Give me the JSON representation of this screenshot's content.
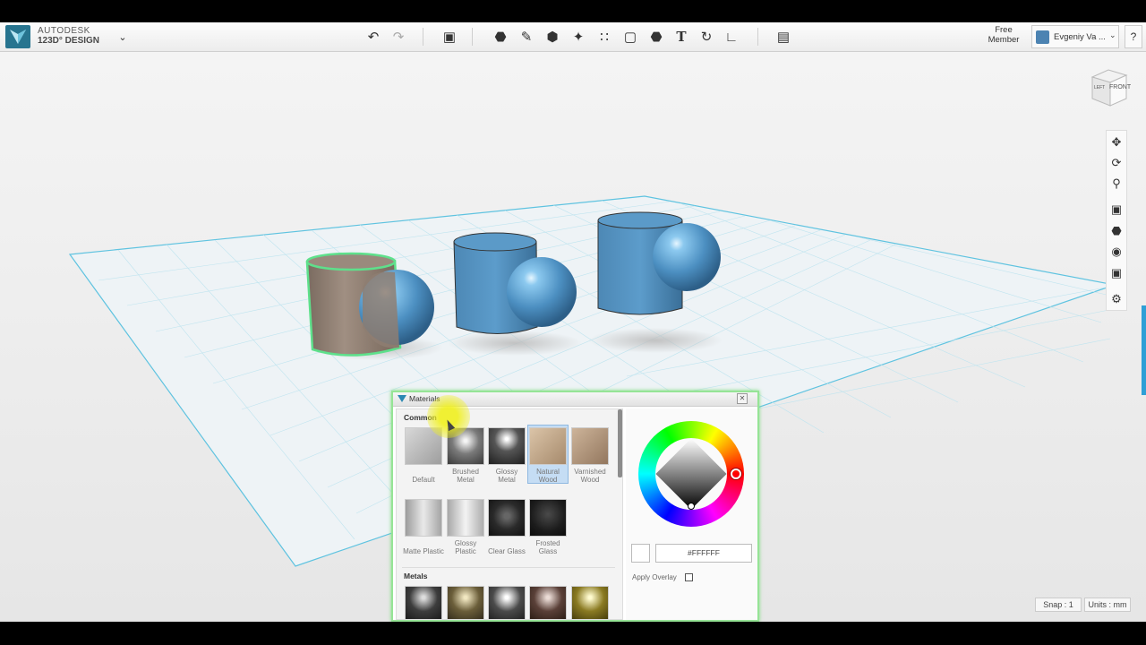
{
  "app": {
    "brand_line1": "AUTODESK",
    "brand_line2": "123D° DESIGN",
    "account": {
      "line1": "Free",
      "line2": "Member"
    },
    "user_name": "Evgeniy Va ...",
    "help": "?"
  },
  "toolbar": {
    "icons": [
      "undo-icon",
      "redo-icon",
      "transform-icon",
      "primitives-icon",
      "sketch-icon",
      "construct-icon",
      "modify-icon",
      "pattern-icon",
      "grouping-icon",
      "combine-icon",
      "text-icon",
      "snap-icon",
      "measure-icon",
      "material-icon"
    ]
  },
  "viewcube": {
    "left_label": "LEFT",
    "front_label": "FRONT"
  },
  "nav_tools": [
    "pan-icon",
    "orbit-icon",
    "zoom-icon",
    "fit-icon",
    "view-icon",
    "visibility-icon",
    "camera-icon",
    "settings-icon"
  ],
  "materials_panel": {
    "title": "Materials",
    "sections": [
      {
        "name": "Common",
        "items": [
          {
            "label_1": "",
            "label_2": "Default",
            "selected": false,
            "color": "#b9b9b9"
          },
          {
            "label_1": "Brushed",
            "label_2": "Metal",
            "selected": false,
            "color": "#7a7a7a"
          },
          {
            "label_1": "Glossy",
            "label_2": "Metal",
            "selected": false,
            "color": "#555555"
          },
          {
            "label_1": "Natural",
            "label_2": "Wood",
            "selected": true,
            "color": "#c1a588"
          },
          {
            "label_1": "Varnished",
            "label_2": "Wood",
            "selected": false,
            "color": "#b59a80"
          },
          {
            "label_1": "",
            "label_2": "Matte Plastic",
            "selected": false,
            "color": "#c9c9c9"
          },
          {
            "label_1": "Glossy",
            "label_2": "Plastic",
            "selected": false,
            "color": "#d2d2d2"
          },
          {
            "label_1": "",
            "label_2": "Clear Glass",
            "selected": false,
            "color": "#3a3a3a"
          },
          {
            "label_1": "Frosted",
            "label_2": "Glass",
            "selected": false,
            "color": "#2e2e2e"
          }
        ]
      },
      {
        "name": "Metals",
        "items": [
          {
            "color": "#3d3d3d"
          },
          {
            "color": "#6b5e3a"
          },
          {
            "color": "#4b4b4b"
          },
          {
            "color": "#5a4038"
          },
          {
            "color": "#8a7a22"
          }
        ]
      }
    ],
    "color_hex": "#FFFFFF",
    "apply_overlay_label": "Apply Overlay"
  },
  "status": {
    "snap": "Snap : 1",
    "units": "Units : mm"
  }
}
